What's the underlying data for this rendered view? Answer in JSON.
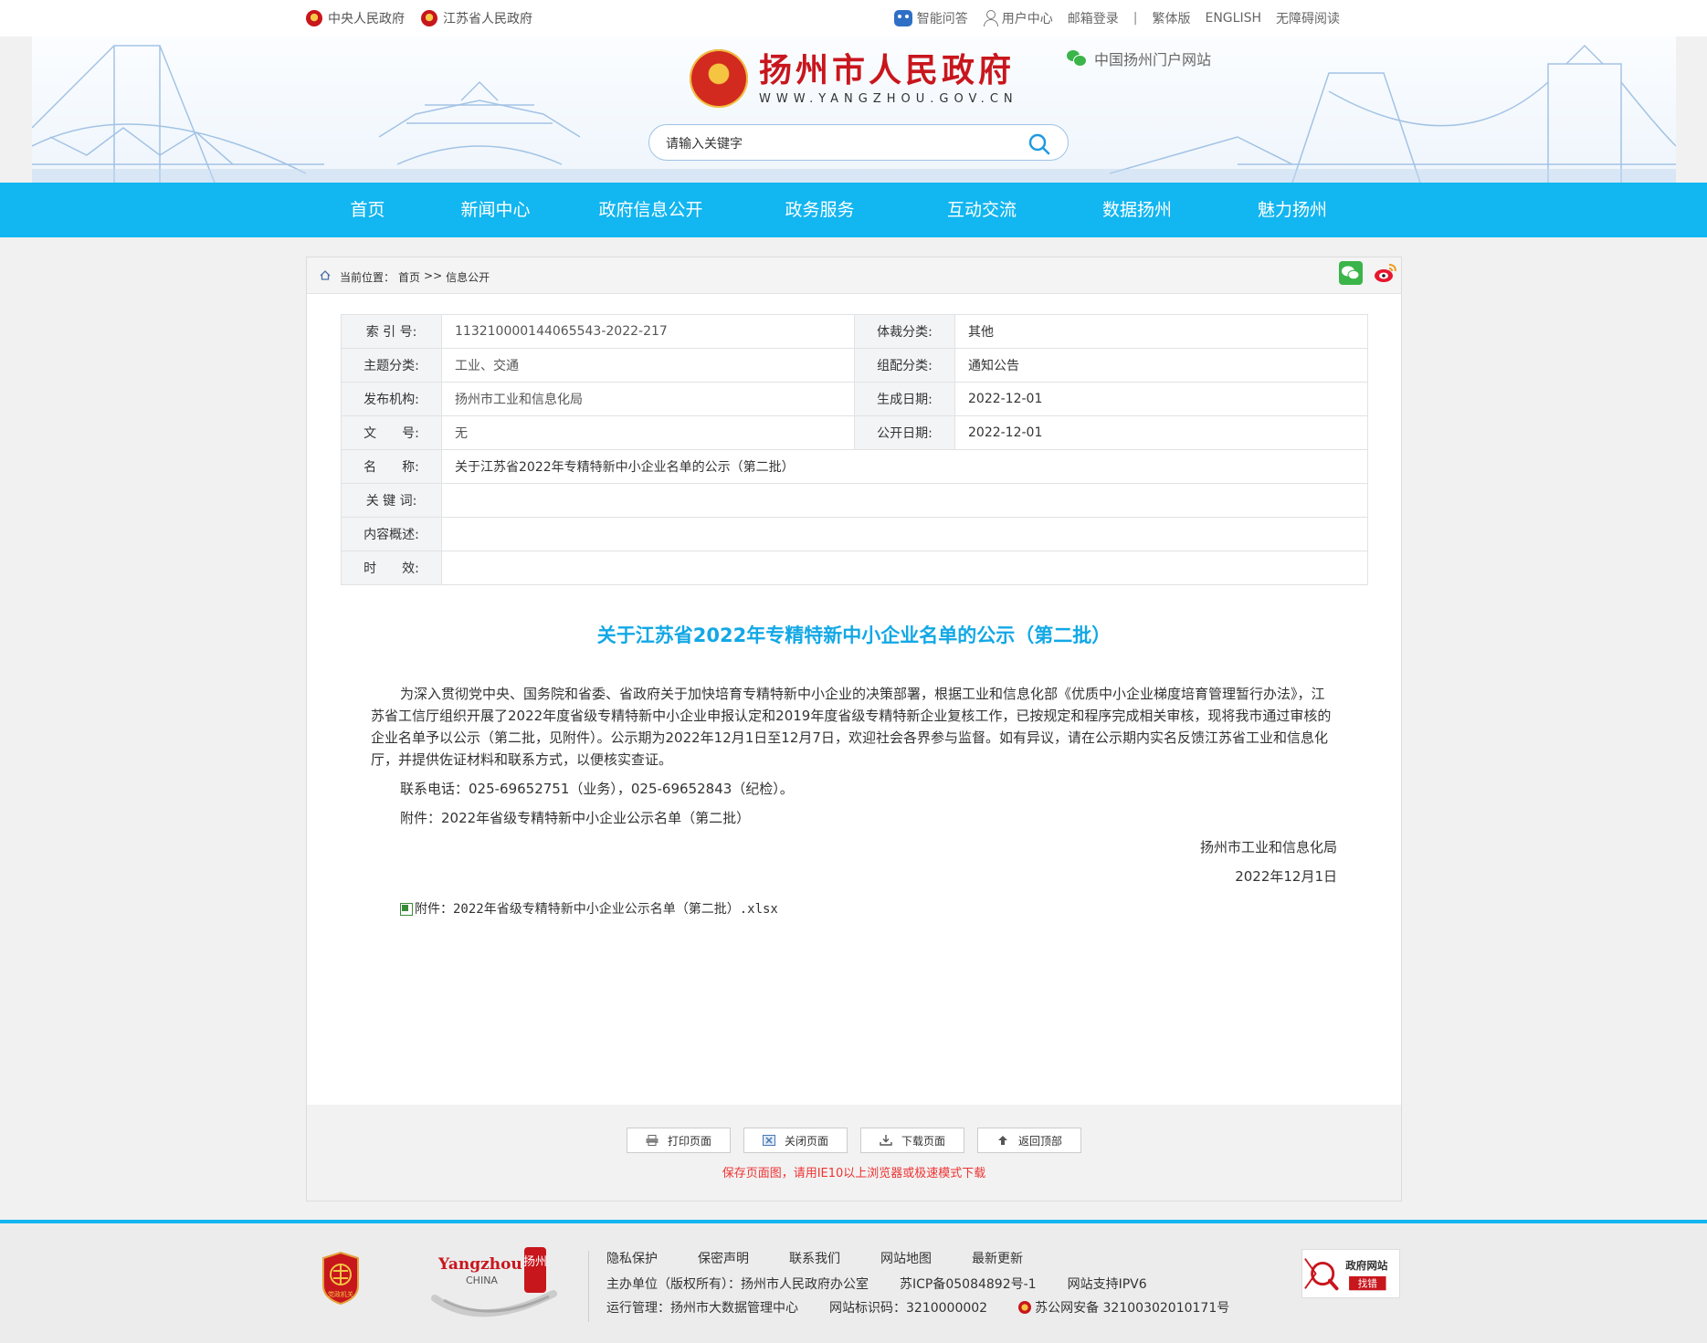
{
  "topbar": {
    "left_links": [
      "中央人民政府",
      "江苏省人民政府"
    ],
    "ai_qa": "智能问答",
    "user_center": "用户中心",
    "mail_login": "邮箱登录",
    "separator": "|",
    "traditional": "繁体版",
    "english": "ENGLISH",
    "accessible": "无障碍阅读"
  },
  "banner": {
    "site_title": "扬州市人民政府",
    "site_domain": "WWW.YANGZHOU.GOV.CN",
    "portal_label": "中国扬州门户网站",
    "search_placeholder": "请输入关键字"
  },
  "nav": {
    "items": [
      "首页",
      "新闻中心",
      "政府信息公开",
      "政务服务",
      "互动交流",
      "数据扬州",
      "魅力扬州"
    ]
  },
  "breadcrumb": {
    "label": "当前位置：",
    "home": "首页",
    "sep": ">>",
    "current": "信息公开"
  },
  "meta": {
    "index_label": "索 引 号:",
    "index_value": "113210000144065543-2022-217",
    "genre_label": "体裁分类:",
    "genre_value": "其他",
    "topic_label": "主题分类:",
    "topic_value": "工业、交通",
    "config_label": "组配分类:",
    "config_value": "通知公告",
    "publisher_label": "发布机构:",
    "publisher_value": "扬州市工业和信息化局",
    "created_label": "生成日期:",
    "created_value": "2022-12-01",
    "docno_label": "文　　号:",
    "docno_value": "无",
    "public_label": "公开日期:",
    "public_value": "2022-12-01",
    "name_label": "名　　称:",
    "name_value": "关于江苏省2022年专精特新中小企业名单的公示（第二批）",
    "keyword_label": "关 键 词:",
    "keyword_value": "",
    "summary_label": "内容概述:",
    "summary_value": "",
    "validity_label": "时　　效:",
    "validity_value": ""
  },
  "article": {
    "title": "关于江苏省2022年专精特新中小企业名单的公示（第二批）",
    "para1": "为深入贯彻党中央、国务院和省委、省政府关于加快培育专精特新中小企业的决策部署，根据工业和信息化部《优质中小企业梯度培育管理暂行办法》，江苏省工信厅组织开展了2022年度省级专精特新中小企业申报认定和2019年度省级专精特新企业复核工作，已按规定和程序完成相关审核，现将我市通过审核的企业名单予以公示（第二批，见附件）。公示期为2022年12月1日至12月7日，欢迎社会各界参与监督。如有异议，请在公示期内实名反馈江苏省工业和信息化厅，并提供佐证材料和联系方式，以便核实查证。",
    "contact": "联系电话：025-69652751（业务），025-69652843（纪检）。",
    "attachment_note": "附件：2022年省级专精特新中小企业公示名单（第二批）",
    "signature": "扬州市工业和信息化局",
    "date": "2022年12月1日",
    "attachment_file": "附件：2022年省级专精特新中小企业公示名单（第二批）.xlsx"
  },
  "toolbar": {
    "print": "打印页面",
    "close": "关闭页面",
    "download": "下载页面",
    "top": "返回顶部",
    "note": "保存页面图，请用IE10以上浏览器或极速模式下载"
  },
  "footer": {
    "links": [
      "隐私保护",
      "保密声明",
      "联系我们",
      "网站地图",
      "最新更新"
    ],
    "host": "主办单位（版权所有）：扬州市人民政府办公室",
    "icp": "苏ICP备05084892号-1",
    "ipv6": "网站支持IPV6",
    "ops": "运行管理：扬州市大数据管理中心",
    "site_code": "网站标识码：3210000002",
    "police": "苏公网安备 32100302010171号",
    "badge_text": "党政机关",
    "logo_en": "Yangzhou",
    "logo_china": "CHINA",
    "logo_cn": "扬州",
    "error_line1": "政府网站",
    "error_line2": "找错"
  },
  "colors": {
    "accent": "#12b6f0",
    "title_blue": "#12a8e6",
    "brand_red": "#c8161d",
    "note_red": "#e33333"
  }
}
